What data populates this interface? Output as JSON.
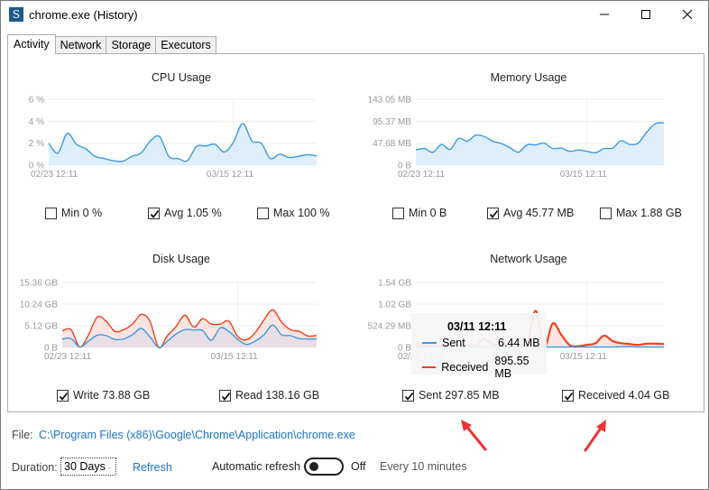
{
  "window": {
    "title": "chrome.exe (History)",
    "app_icon_letter": "S",
    "controls": [
      "minimize",
      "maximize",
      "close"
    ]
  },
  "tabs": [
    {
      "label": "Activity",
      "active": true
    },
    {
      "label": "Network",
      "active": false
    },
    {
      "label": "Storage",
      "active": false
    },
    {
      "label": "Executors",
      "active": false
    }
  ],
  "colors": {
    "blue_line": "#3b9ae1",
    "blue_fill": "#d8ebfa",
    "red_line": "#f2401e",
    "red_fill": "#fbe0dc",
    "link": "#1a73c8",
    "arrow": "#ee3333"
  },
  "chart_data": [
    {
      "type": "area",
      "title": "CPU Usage",
      "yticks": [
        "0 %",
        "2 %",
        "4 %",
        "6 %"
      ],
      "ylim": [
        0,
        6
      ],
      "xticks": [
        "02/23 12:11",
        "03/15 12:11"
      ],
      "series": [
        {
          "name": "CPU",
          "color": "#3b9ae1",
          "fill": "#d8ebfa",
          "values": [
            2.0,
            1.1,
            2.9,
            1.9,
            1.5,
            0.8,
            0.6,
            0.4,
            0.35,
            0.8,
            1.1,
            2.2,
            2.6,
            0.8,
            0.6,
            0.4,
            1.7,
            1.75,
            1.9,
            1.2,
            2.1,
            3.8,
            2.2,
            2.0,
            0.6,
            1.0,
            0.7,
            0.8,
            0.95,
            0.85
          ]
        }
      ],
      "checkboxes": [
        {
          "label": "Min 0 %",
          "checked": false
        },
        {
          "label": "Avg 1.05 %",
          "checked": true
        },
        {
          "label": "Max 100 %",
          "checked": false
        }
      ]
    },
    {
      "type": "area",
      "title": "Memory Usage",
      "yticks": [
        "0 B",
        "47.68 MB",
        "95.37 MB",
        "143.05 MB"
      ],
      "ylim": [
        0,
        143.05
      ],
      "xticks": [
        "02/23 12:11",
        "03/15 12:11"
      ],
      "series": [
        {
          "name": "Memory",
          "color": "#3b9ae1",
          "fill": "#d8ebfa",
          "values": [
            33,
            36,
            28,
            45,
            34,
            58,
            52,
            65,
            62,
            52,
            47,
            38,
            28,
            44,
            44,
            48,
            36,
            37,
            30,
            33,
            30,
            27,
            36,
            37,
            53,
            45,
            48,
            72,
            90,
            92
          ]
        }
      ],
      "checkboxes": [
        {
          "label": "Min 0 B",
          "checked": false
        },
        {
          "label": "Avg 45.77 MB",
          "checked": true
        },
        {
          "label": "Max 1.88 GB",
          "checked": false
        }
      ]
    },
    {
      "type": "area",
      "title": "Disk Usage",
      "yticks": [
        "0 B",
        "5.12 GB",
        "10.24 GB",
        "15.36 GB"
      ],
      "ylim": [
        0,
        15.36
      ],
      "xticks": [
        "02/23 12:11",
        "03/15 12:11"
      ],
      "series": [
        {
          "name": "Write",
          "color": "#3b9ae1",
          "fill": "#e4dde6",
          "values": [
            2.0,
            2.1,
            0.1,
            1.5,
            2.9,
            2.8,
            1.9,
            2.0,
            3.0,
            4.5,
            2.5,
            0.0,
            1.5,
            3.2,
            4.2,
            4.1,
            4.0,
            1.7,
            4.6,
            3.8,
            1.9,
            0.7,
            1.5,
            3.0,
            5.3,
            3.0,
            2.8,
            2.1,
            2.0,
            2.0
          ]
        },
        {
          "name": "Read",
          "color": "#f2401e",
          "fill": "#fbe0dc",
          "values": [
            3.9,
            4.2,
            0.1,
            3.0,
            7.2,
            6.2,
            3.8,
            4.2,
            5.5,
            7.8,
            6.2,
            0.0,
            2.8,
            5.0,
            7.6,
            4.8,
            6.8,
            5.5,
            5.5,
            6.2,
            2.6,
            1.8,
            3.5,
            6.5,
            8.9,
            6.0,
            4.2,
            3.8,
            2.7,
            2.8
          ]
        }
      ],
      "checkboxes": [
        {
          "label": "Write 73.88 GB",
          "checked": true
        },
        {
          "label": "Read 138.16 GB",
          "checked": true
        }
      ]
    },
    {
      "type": "area",
      "title": "Network Usage",
      "yticks": [
        "0 B",
        "524.29 MB",
        "1.02 GB",
        "1.54 GB"
      ],
      "ylim": [
        0,
        1.54
      ],
      "xticks": [
        "02/23 12:11",
        "03/15 12:11"
      ],
      "series": [
        {
          "name": "Sent",
          "color": "#3b9ae1",
          "fill": "none",
          "values": [
            0.01,
            0.01,
            0.01,
            0.01,
            0.01,
            0.01,
            0.01,
            0.01,
            0.01,
            0.01,
            0.01,
            0.01,
            0.01,
            0.01,
            0.01,
            0.01,
            0.01,
            0.01,
            0.01,
            0.01,
            0.01,
            0.01,
            0.01,
            0.01,
            0.02,
            0.02,
            0.01,
            0.01,
            0.01,
            0.01
          ]
        },
        {
          "name": "Received",
          "color": "#f2401e",
          "fill": "#fbe0dc",
          "values": [
            0.05,
            0.05,
            0.04,
            0.05,
            0.05,
            0.05,
            0.06,
            0.05,
            0.2,
            0.08,
            0.05,
            0.06,
            0.08,
            0.06,
            0.87,
            0.02,
            0.57,
            0.3,
            0.05,
            0.03,
            0.06,
            0.1,
            0.28,
            0.15,
            0.1,
            0.08,
            0.06,
            0.09,
            0.09,
            0.08
          ]
        }
      ],
      "tooltip": {
        "title": "03/11 12:11",
        "rows": [
          {
            "name": "Sent",
            "value": "6.44 MB",
            "color": "#3b9ae1"
          },
          {
            "name": "Received",
            "value": "895.55 MB",
            "color": "#f2401e"
          }
        ]
      },
      "checkboxes": [
        {
          "label": "Sent 297.85 MB",
          "checked": true
        },
        {
          "label": "Received 4.04 GB",
          "checked": true
        }
      ]
    }
  ],
  "footer": {
    "file_label": "File:",
    "file_path": "C:\\Program Files (x86)\\Google\\Chrome\\Application\\chrome.exe",
    "duration_label": "Duration:",
    "duration_value": "30 Days",
    "refresh_label": "Refresh",
    "auto_refresh_label": "Automatic refresh",
    "auto_refresh_state": "Off",
    "auto_refresh_interval": "Every 10 minutes"
  }
}
